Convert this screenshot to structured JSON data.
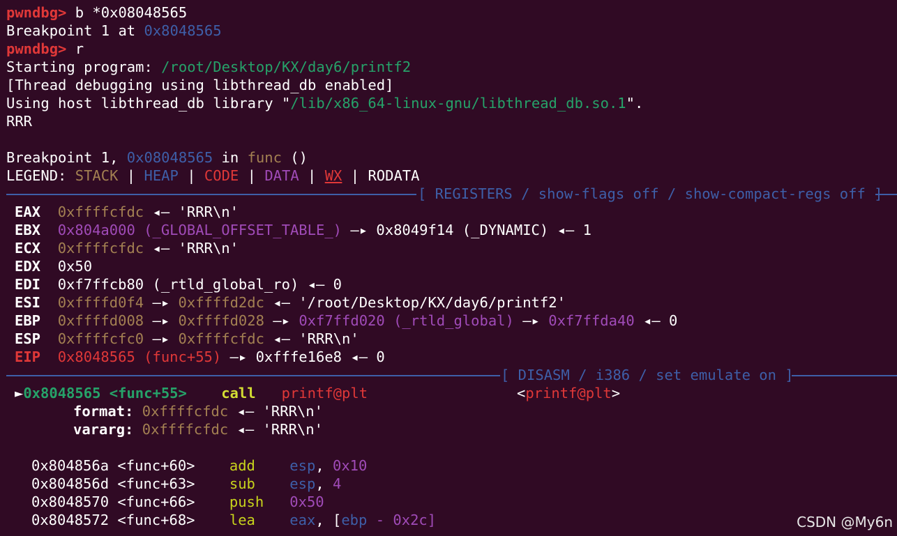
{
  "prompt": "pwndbg>",
  "lines": {
    "l1_cmd": " b *0x08048565",
    "l2_a": "Breakpoint 1 at ",
    "l2_b": "0x8048565",
    "l3_cmd": " r",
    "l4_a": "Starting program: ",
    "l4_b": "/root/Desktop/KX/day6/printf2",
    "l5": "[Thread debugging using libthread_db enabled]",
    "l6_a": "Using host libthread_db library \"",
    "l6_b": "/lib/x86_64-linux-gnu/libthread_db.so.1",
    "l6_c": "\".",
    "l7": "RRR",
    "l9_a": "Breakpoint 1, ",
    "l9_b": "0x08048565",
    "l9_c": " in ",
    "l9_d": "func",
    "l9_e": " ()"
  },
  "legend": {
    "label": "LEGEND: ",
    "stack": "STACK",
    "heap": "HEAP",
    "code": "CODE",
    "data": "DATA",
    "wx": "WX",
    "rodata": "RODATA",
    "pipe": " | "
  },
  "registers_header": "[ REGISTERS / show-flags off / show-compact-regs off ]",
  "disasm_header": "[ DISASM / i386 / set emulate on ]",
  "registers": {
    "eax": [
      "EAX",
      "0xffffcfdc",
      " ◂— ",
      "'RRR\\n'"
    ],
    "ebx": [
      "EBX",
      "0x804a000 (_GLOBAL_OFFSET_TABLE_)",
      " —▸ ",
      "0x8049f14 (_DYNAMIC)",
      " ◂— ",
      "1"
    ],
    "ecx": [
      "ECX",
      "0xffffcfdc",
      " ◂— ",
      "'RRR\\n'"
    ],
    "edx": [
      "EDX",
      "0x50"
    ],
    "edi": [
      "EDI",
      "0xf7ffcb80 (_rtld_global_ro)",
      " ◂— ",
      "0"
    ],
    "esi": [
      "ESI",
      "0xffffd0f4",
      " —▸ ",
      "0xffffd2dc",
      " ◂— ",
      "'/root/Desktop/KX/day6/printf2'"
    ],
    "ebp": [
      "EBP",
      "0xffffd008",
      " —▸ ",
      "0xffffd028",
      " —▸ ",
      "0xf7ffd020 (_rtld_global)",
      " —▸ ",
      "0xf7ffda40",
      " ◂— ",
      "0"
    ],
    "esp": [
      "ESP",
      "0xffffcfc0",
      " —▸ ",
      "0xffffcfdc",
      " ◂— ",
      "'RRR\\n'"
    ],
    "eip": [
      "EIP",
      "0x8048565 (func+55)",
      " —▸ ",
      "0xfffe16e8",
      " ◂— ",
      "0"
    ]
  },
  "disasm": {
    "cur_marker": "►",
    "cur_addr": "0x8048565 <func+55>",
    "cur_mnemonic": "call",
    "cur_operand": "printf@plt",
    "cur_comment_a": "<",
    "cur_comment_b": "printf@plt",
    "cur_comment_c": ">",
    "fmt_label": "format:",
    "fmt_val": "0xffffcfdc",
    "fmt_arrow": " ◂— ",
    "fmt_str": "'RRR\\n'",
    "var_label": "vararg:",
    "var_val": "0xffffcfdc",
    "var_arrow": " ◂— ",
    "var_str": "'RRR\\n'",
    "rows": [
      {
        "addr": "0x804856a <func+60>",
        "mn": "add",
        "op1": "esp",
        "sep": ", ",
        "op2": "0x10",
        "op3": ""
      },
      {
        "addr": "0x804856d <func+63>",
        "mn": "sub",
        "op1": "esp",
        "sep": ", ",
        "op2": "4",
        "op3": ""
      },
      {
        "addr": "0x8048570 <func+66>",
        "mn": "push",
        "op1": "",
        "sep": "",
        "op2": "0x50",
        "op3": ""
      },
      {
        "addr": "0x8048572 <func+68>",
        "mn": "lea",
        "op1": "eax",
        "sep": ", [",
        "op2": "ebp",
        "op3": " - 0x2c]"
      }
    ]
  },
  "watermark": "CSDN @My6n",
  "colors": {
    "background": "#300a24",
    "prompt": "#e03838",
    "blue": "#3e5fa8",
    "green": "#26a269",
    "stack": "#a38052",
    "data": "#a04bb8",
    "mnemonic": "#c8d41c"
  }
}
